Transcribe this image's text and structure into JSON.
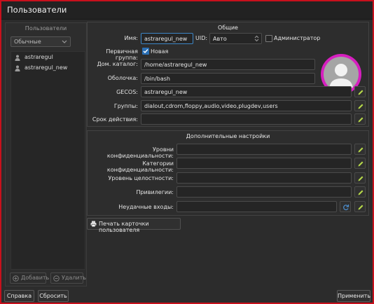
{
  "window": {
    "title": "Пользователи"
  },
  "left": {
    "header": "Пользователи",
    "filter_value": "Обычные",
    "users": [
      "astraregul",
      "astraregul_new"
    ],
    "add_label": "Добавить",
    "remove_label": "Удалить"
  },
  "general": {
    "title": "Общие",
    "name_label": "Имя:",
    "name_value": "astraregul_new",
    "uid_label": "UID:",
    "uid_value": "Авто",
    "admin_label": "Администратор",
    "primary_group_label": "Первичная группа:",
    "new_label": "Новая",
    "home_label": "Дом. каталог:",
    "home_value": "/home/astraregul_new",
    "shell_label": "Оболочка:",
    "shell_value": "/bin/bash",
    "gecos_label": "GECOS:",
    "gecos_value": "astraregul_new",
    "groups_label": "Группы:",
    "groups_value": "dialout,cdrom,floppy,audio,video,plugdev,users",
    "expiry_label": "Срок действия:",
    "expiry_value": ""
  },
  "extra": {
    "title": "Дополнительные настройки",
    "conf_levels_label": "Уровни конфиденциальности:",
    "conf_categories_label": "Категории конфиденциальности:",
    "integrity_label": "Уровень целостности:",
    "privileges_label": "Привилегии:",
    "failed_logins_label": "Неудачные входы:"
  },
  "print_label": "Печать карточки пользователя",
  "bottom": {
    "help_label": "Справка",
    "reset_label": "Сбросить",
    "apply_label": "Применить"
  },
  "colors": {
    "accent": "#3d86c6",
    "avatar_ring": "#d61fbf",
    "window_border": "#c8101c"
  }
}
